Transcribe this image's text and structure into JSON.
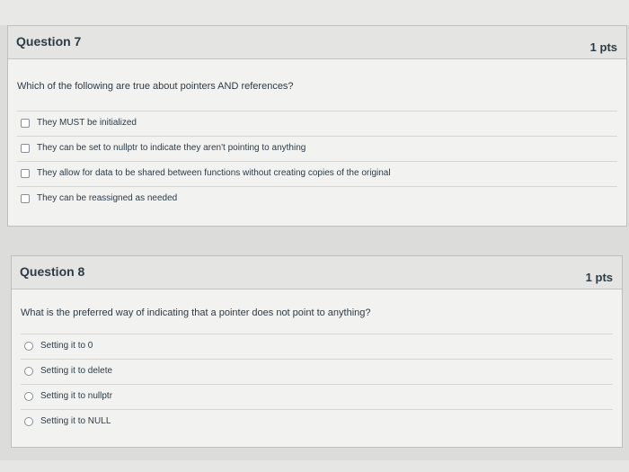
{
  "questions": [
    {
      "title": "Question 7",
      "points": "1 pts",
      "text": "Which of the following are true about pointers AND references?",
      "answer_type": "checkbox",
      "answers": [
        "They MUST be initialized",
        "They can be set to nullptr to indicate they aren't pointing to anything",
        "They allow for data to be shared between functions without creating copies of the original",
        "They can be reassigned as needed"
      ]
    },
    {
      "title": "Question 8",
      "points": "1 pts",
      "text": "What is the preferred way of indicating that a pointer does not point to anything?",
      "answer_type": "radio",
      "answers": [
        "Setting it to 0",
        "Setting it to delete",
        "Setting it to nullptr",
        "Setting it to NULL"
      ]
    }
  ],
  "colors": {
    "text": "#2d3b45",
    "card_bg": "#f2f2f1",
    "header_bg": "#e4e4e2"
  }
}
